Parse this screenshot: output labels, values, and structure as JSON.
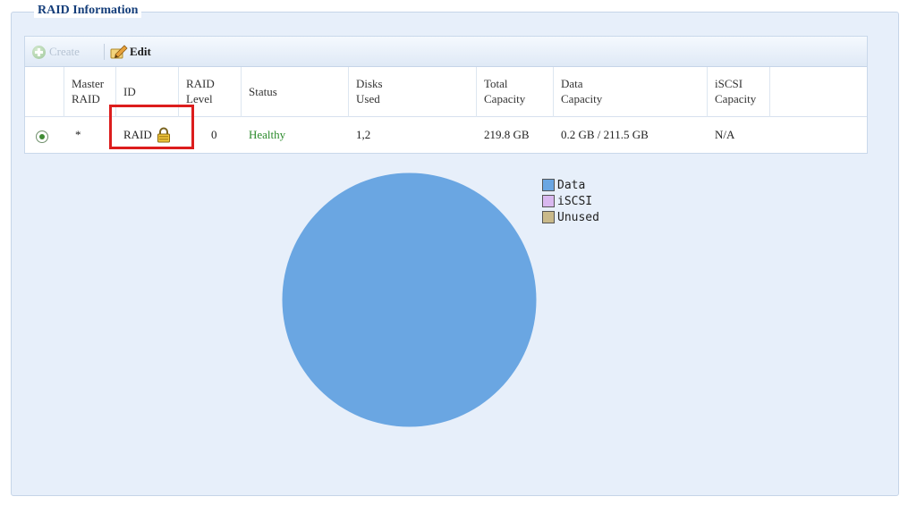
{
  "section_title": "RAID Information",
  "toolbar": {
    "create_label": "Create",
    "edit_label": "Edit"
  },
  "table": {
    "headers": {
      "master": [
        "Master",
        "RAID"
      ],
      "id": "ID",
      "level": [
        "RAID",
        "Level"
      ],
      "status": "Status",
      "disks": [
        "Disks",
        "Used"
      ],
      "total": [
        "Total",
        "Capacity"
      ],
      "data": [
        "Data",
        "Capacity"
      ],
      "iscsi": [
        "iSCSI",
        "Capacity"
      ]
    },
    "rows": [
      {
        "selected": true,
        "master": "*",
        "id": "RAID",
        "locked": true,
        "level": "0",
        "status": "Healthy",
        "disks": "1,2",
        "total": "219.8 GB",
        "data": "0.2 GB / 211.5 GB",
        "iscsi": "N/A"
      }
    ]
  },
  "colors": {
    "data": "#6aa6e2",
    "iscsi": "#d9b8ef",
    "unused": "#c9b98a",
    "healthy": "#2a8a2a",
    "highlight": "#dc1d1d"
  },
  "chart_data": {
    "type": "pie",
    "legend": "top-right",
    "slices": [
      {
        "name": "Data",
        "value": 100
      },
      {
        "name": "iSCSI",
        "value": 0
      },
      {
        "name": "Unused",
        "value": 0
      }
    ]
  },
  "icons": {
    "create": "add-circle-icon",
    "edit": "pencil-edit-icon",
    "lock": "lock-icon",
    "radio": "radio-selected-icon"
  }
}
